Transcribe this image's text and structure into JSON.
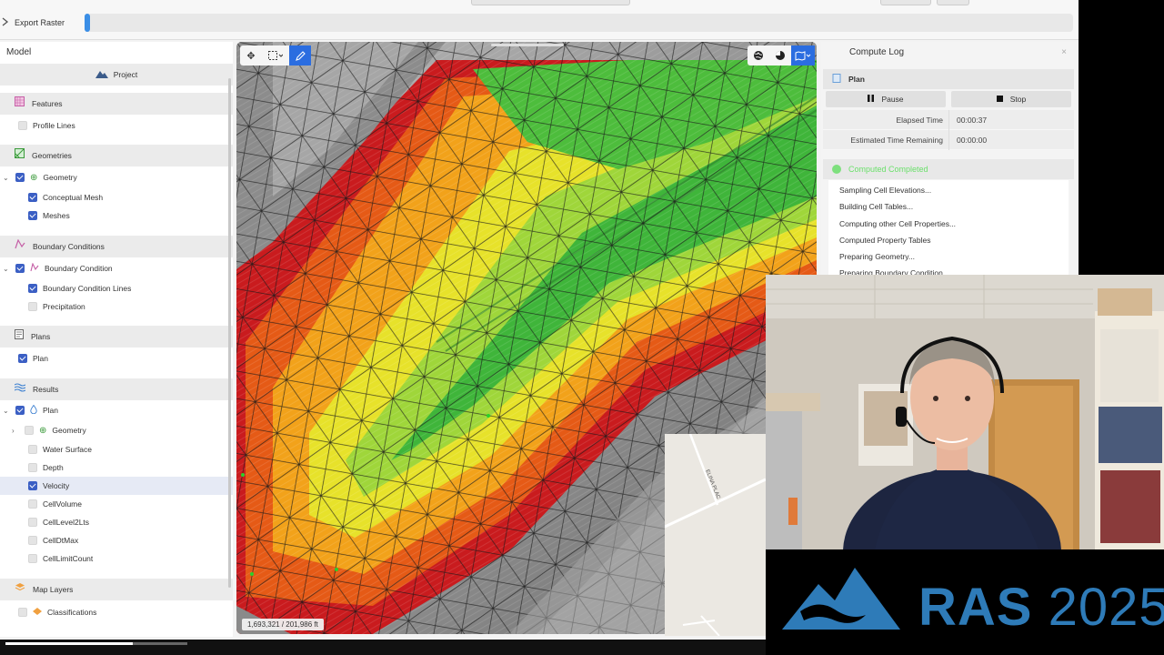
{
  "topbar": {
    "export_label": "Export Raster",
    "progress_fraction": 0.005
  },
  "model": {
    "title": "Model",
    "project_label": "Project",
    "sections": {
      "features": "Features",
      "geometries": "Geometries",
      "boundary_conditions": "Boundary Conditions",
      "plans": "Plans",
      "results": "Results",
      "map_layers": "Map Layers"
    },
    "items": {
      "profile_lines": "Profile Lines",
      "geometry": "Geometry",
      "conceptual_mesh": "Conceptual Mesh",
      "meshes": "Meshes",
      "boundary_condition": "Boundary Condition",
      "boundary_condition_lines": "Boundary Condition Lines",
      "precipitation": "Precipitation",
      "plan": "Plan",
      "results_plan": "Plan",
      "results_geometry": "Geometry",
      "water_surface": "Water Surface",
      "depth": "Depth",
      "velocity": "Velocity",
      "cell_volume": "CellVolume",
      "cell_level2lts": "CellLevel2Lts",
      "cell_dtmax": "CellDtMax",
      "cell_limit_count": "CellLimitCount",
      "classifications": "Classifications"
    }
  },
  "map": {
    "coords": "1,693,321  /  201,986 ft",
    "inset_street": "ELINA PLAC"
  },
  "compute_log": {
    "title": "Compute Log",
    "plan_label": "Plan",
    "pause_label": "Pause",
    "stop_label": "Stop",
    "elapsed_label": "Elapsed Time",
    "elapsed_value": "00:00:37",
    "remaining_label": "Estimated Time Remaining",
    "remaining_value": "00:00:00",
    "status": "Computed Completed",
    "entries": [
      "Sampling Cell Elevations...",
      "Building Cell Tables...",
      "Computing other Cell Properties...",
      "Computed Property Tables",
      "Preparing Geometry...",
      "Preparing Boundary Condition..."
    ]
  },
  "brand": {
    "word": "RAS",
    "year": "2025",
    "color": "#2e7bb8"
  }
}
